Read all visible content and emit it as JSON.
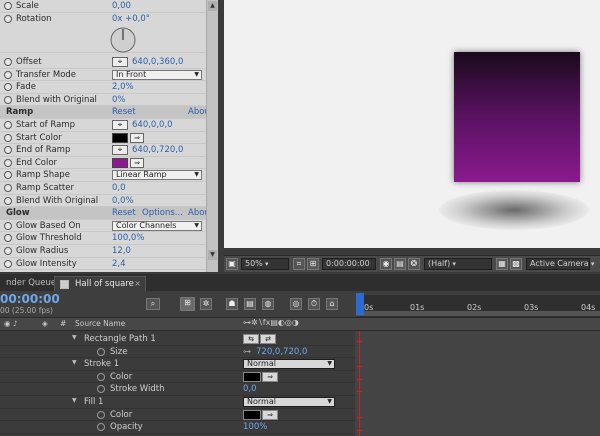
{
  "effect_controls": {
    "rows": [
      {
        "label": "Scale",
        "value": "0,00"
      },
      {
        "label": "Rotation",
        "value": "0x +0,0°"
      },
      {
        "label": "Offset",
        "value": "640,0,360,0"
      },
      {
        "label": "Transfer Mode",
        "value": "In Front"
      },
      {
        "label": "Fade",
        "value": "2,0%"
      },
      {
        "label": "Blend with Original",
        "value": "0%"
      },
      {
        "label": "Ramp",
        "reset": "Reset",
        "about": "Abou"
      },
      {
        "label": "Start of Ramp",
        "value": "640,0,0,0"
      },
      {
        "label": "Start Color",
        "color": "#000000"
      },
      {
        "label": "End of Ramp",
        "value": "640,0,720,0"
      },
      {
        "label": "End Color",
        "color": "#8a1a8e"
      },
      {
        "label": "Ramp Shape",
        "value": "Linear Ramp"
      },
      {
        "label": "Ramp Scatter",
        "value": "0,0"
      },
      {
        "label": "Blend With Original",
        "value": "0,0%"
      },
      {
        "label": "Glow",
        "reset": "Reset",
        "options": "Options...",
        "about": "Abou"
      },
      {
        "label": "Glow Based On",
        "value": "Color Channels"
      },
      {
        "label": "Glow Threshold",
        "value": "100,0%"
      },
      {
        "label": "Glow Radius",
        "value": "12,0"
      },
      {
        "label": "Glow Intensity",
        "value": "2,4"
      }
    ]
  },
  "viewer": {
    "zoom": "50%",
    "timecode": "0:00:00:00",
    "resolution": "(Half)",
    "camera": "Active Camera"
  },
  "tabs": {
    "render_queue": "nder Queue",
    "comp": "Hall of square"
  },
  "timeline": {
    "timecode": "00:00:00",
    "fps": "00 (25.00 fps)",
    "col_hash": "#",
    "col_source": "Source Name",
    "ruler": [
      "0s",
      "01s",
      "02s",
      "03s",
      "04s"
    ],
    "rows": [
      {
        "label": "Rectangle Path 1"
      },
      {
        "label": "Size",
        "value": "720,0,720,0"
      },
      {
        "label": "Stroke 1",
        "mode": "Normal"
      },
      {
        "label": "Color"
      },
      {
        "label": "Stroke Width",
        "value": "0,0"
      },
      {
        "label": "Fill 1",
        "mode": "Normal"
      },
      {
        "label": "Color"
      },
      {
        "label": "Opacity",
        "value": "100%"
      }
    ]
  },
  "colors": {
    "ramp_start": "#000000",
    "ramp_end": "#8a1a8e",
    "accent": "#2b5ea7"
  }
}
